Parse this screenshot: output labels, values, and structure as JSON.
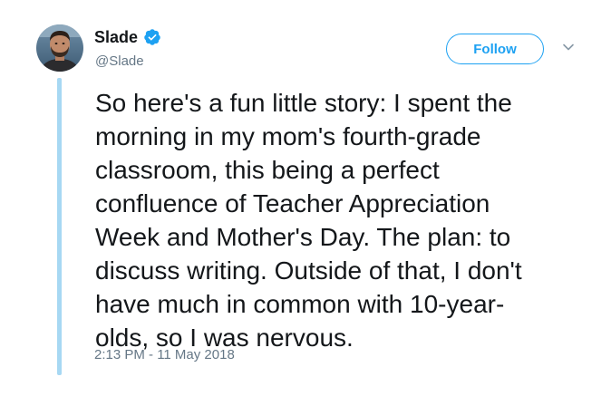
{
  "tweet": {
    "author": {
      "display_name": "Slade",
      "username": "@Slade",
      "verified": true,
      "avatar_icon": "avatar-photo-icon"
    },
    "follow_label": "Follow",
    "menu_icon": "chevron-down-icon",
    "text": "So here's a fun little story: I spent the\nmorning in my mom's fourth-grade\nclassroom, this being a perfect\nconfluence of Teacher Appreciation\nWeek and Mother's Day. The plan: to\ndiscuss writing. Outside of that, I don't\nhave much in common with 10-year-\nolds, so I was nervous.",
    "timestamp": "2:13 PM - 11 May 2018"
  },
  "colors": {
    "accent": "#1da1f2",
    "thread_line": "#a7d8f3",
    "secondary_text": "#657786",
    "primary_text": "#14171a"
  }
}
